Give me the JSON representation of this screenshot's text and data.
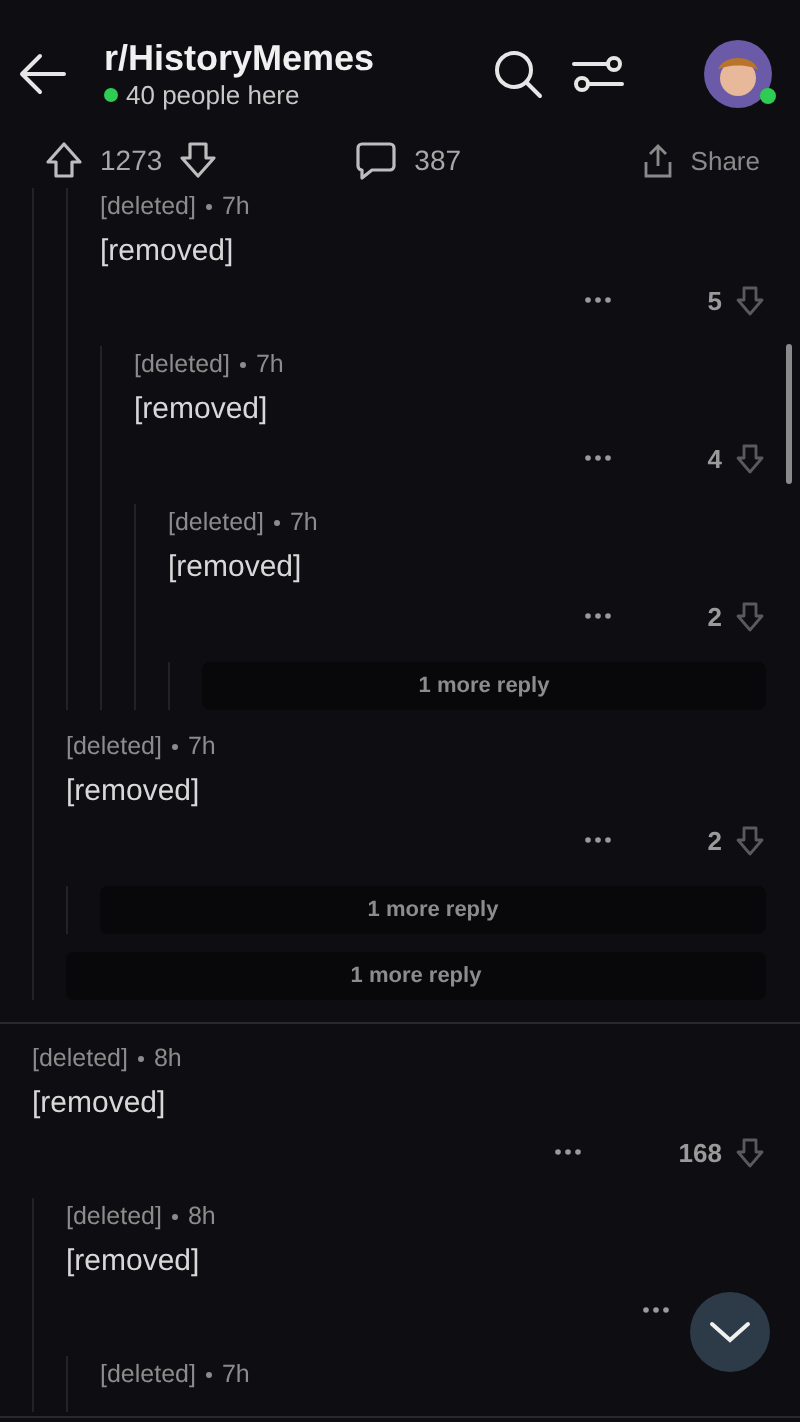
{
  "header": {
    "title": "r/HistoryMemes",
    "online": "40 people here",
    "avatar_online": true
  },
  "post_bar": {
    "score": "1273",
    "comments": "387",
    "share": "Share"
  },
  "threads": [
    {
      "replies": [
        {
          "kind": "continuation",
          "replies": [
            {
              "kind": "comment",
              "author": "[deleted]",
              "time": "7h",
              "body": "[removed]",
              "score": "5",
              "replies": [
                {
                  "kind": "comment",
                  "author": "[deleted]",
                  "time": "7h",
                  "body": "[removed]",
                  "score": "4",
                  "replies": [
                    {
                      "kind": "comment",
                      "author": "[deleted]",
                      "time": "7h",
                      "body": "[removed]",
                      "score": "2",
                      "replies": [
                        {
                          "kind": "more",
                          "label": "1 more reply"
                        }
                      ]
                    }
                  ]
                }
              ]
            }
          ]
        },
        {
          "kind": "comment",
          "author": "[deleted]",
          "time": "7h",
          "body": "[removed]",
          "score": "2",
          "replies": [
            {
              "kind": "more",
              "label": "1 more reply"
            }
          ]
        },
        {
          "kind": "more",
          "label": "1 more reply"
        }
      ]
    },
    {
      "root": {
        "kind": "comment",
        "author": "[deleted]",
        "time": "8h",
        "body": "[removed]",
        "score": "168"
      },
      "replies": [
        {
          "kind": "comment",
          "author": "[deleted]",
          "time": "8h",
          "body": "[removed]",
          "replies": [
            {
              "kind": "comment",
              "author": "[deleted]",
              "time": "7h"
            }
          ]
        }
      ]
    }
  ]
}
